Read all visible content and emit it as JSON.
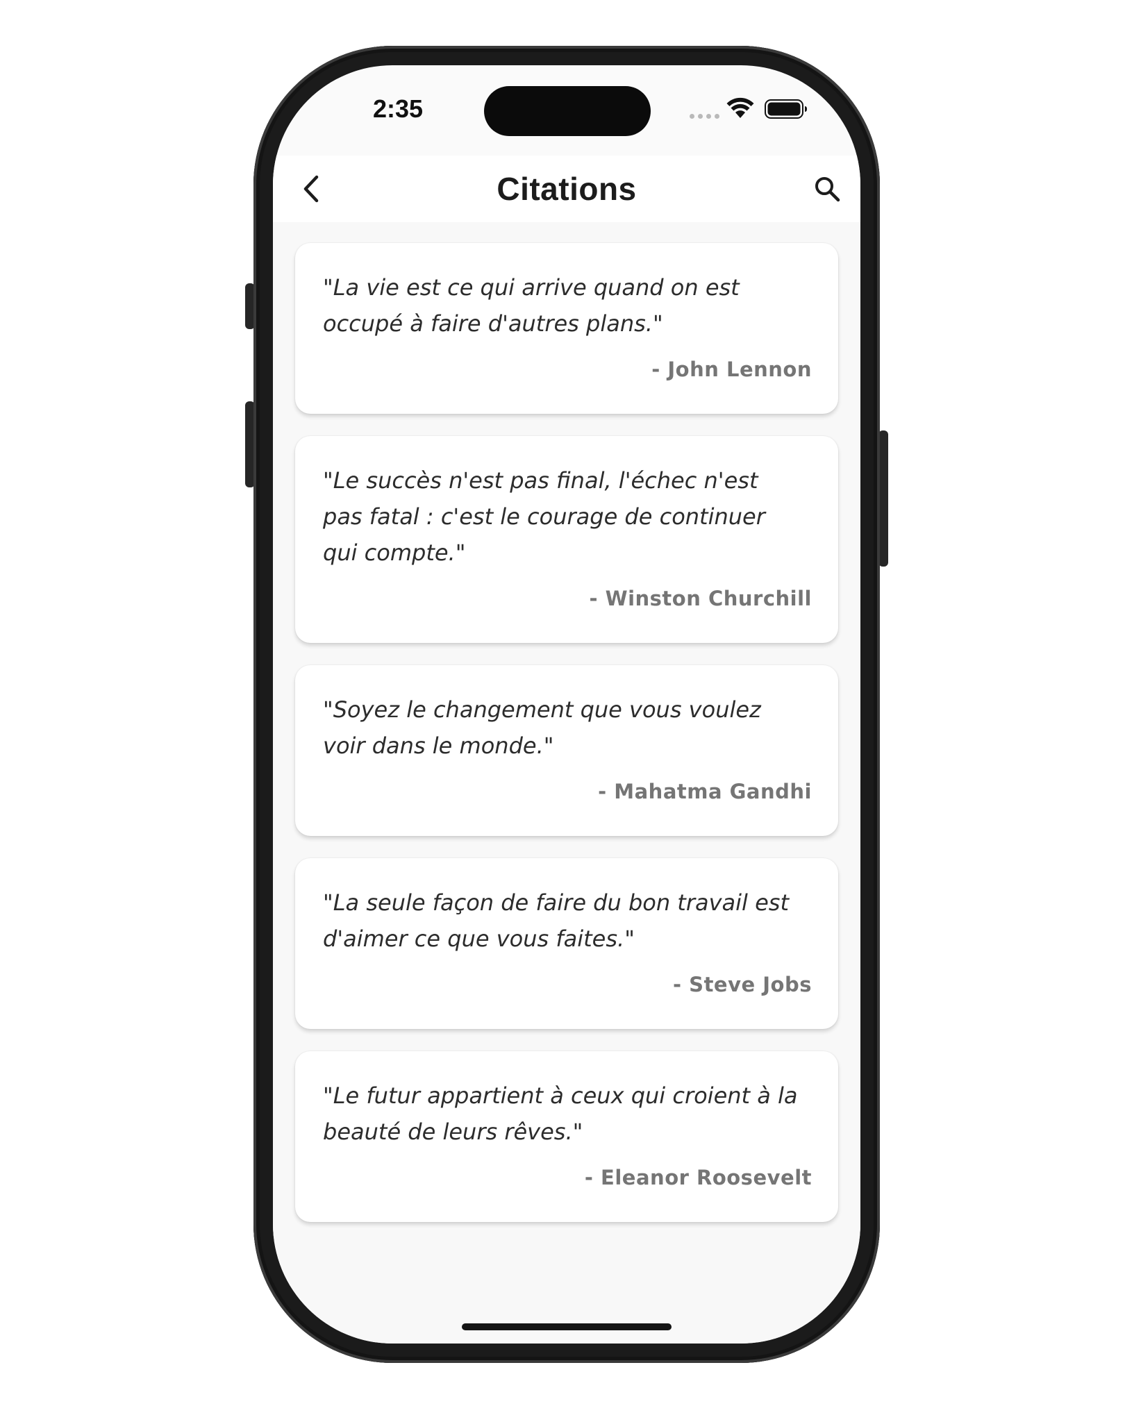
{
  "status_bar": {
    "time": "2:35"
  },
  "app_bar": {
    "title": "Citations",
    "back_icon": "chevron-left-icon",
    "search_icon": "search-icon"
  },
  "quotes": [
    {
      "text": "\"La vie est ce qui arrive quand on est\noccupé à faire d'autres plans.\"",
      "author": "- John Lennon"
    },
    {
      "text": "\"Le succès n'est pas final, l'échec n'est\npas fatal : c'est le courage de continuer\nqui compte.\"",
      "author": "- Winston Churchill"
    },
    {
      "text": "\"Soyez le changement que vous voulez\nvoir dans le monde.\"",
      "author": "- Mahatma Gandhi"
    },
    {
      "text": "\"La seule façon de faire du bon travail est\nd'aimer ce que vous faites.\"",
      "author": "- Steve Jobs"
    },
    {
      "text": "\"Le futur appartient à ceux qui croient à la\nbeauté de leurs rêves.\"",
      "author": "- Eleanor Roosevelt"
    }
  ],
  "colors": {
    "background": "#fafafa",
    "card": "#ffffff",
    "quote_text": "#2c2c2c",
    "author_text": "#757575",
    "title_text": "#1c1c1c"
  }
}
